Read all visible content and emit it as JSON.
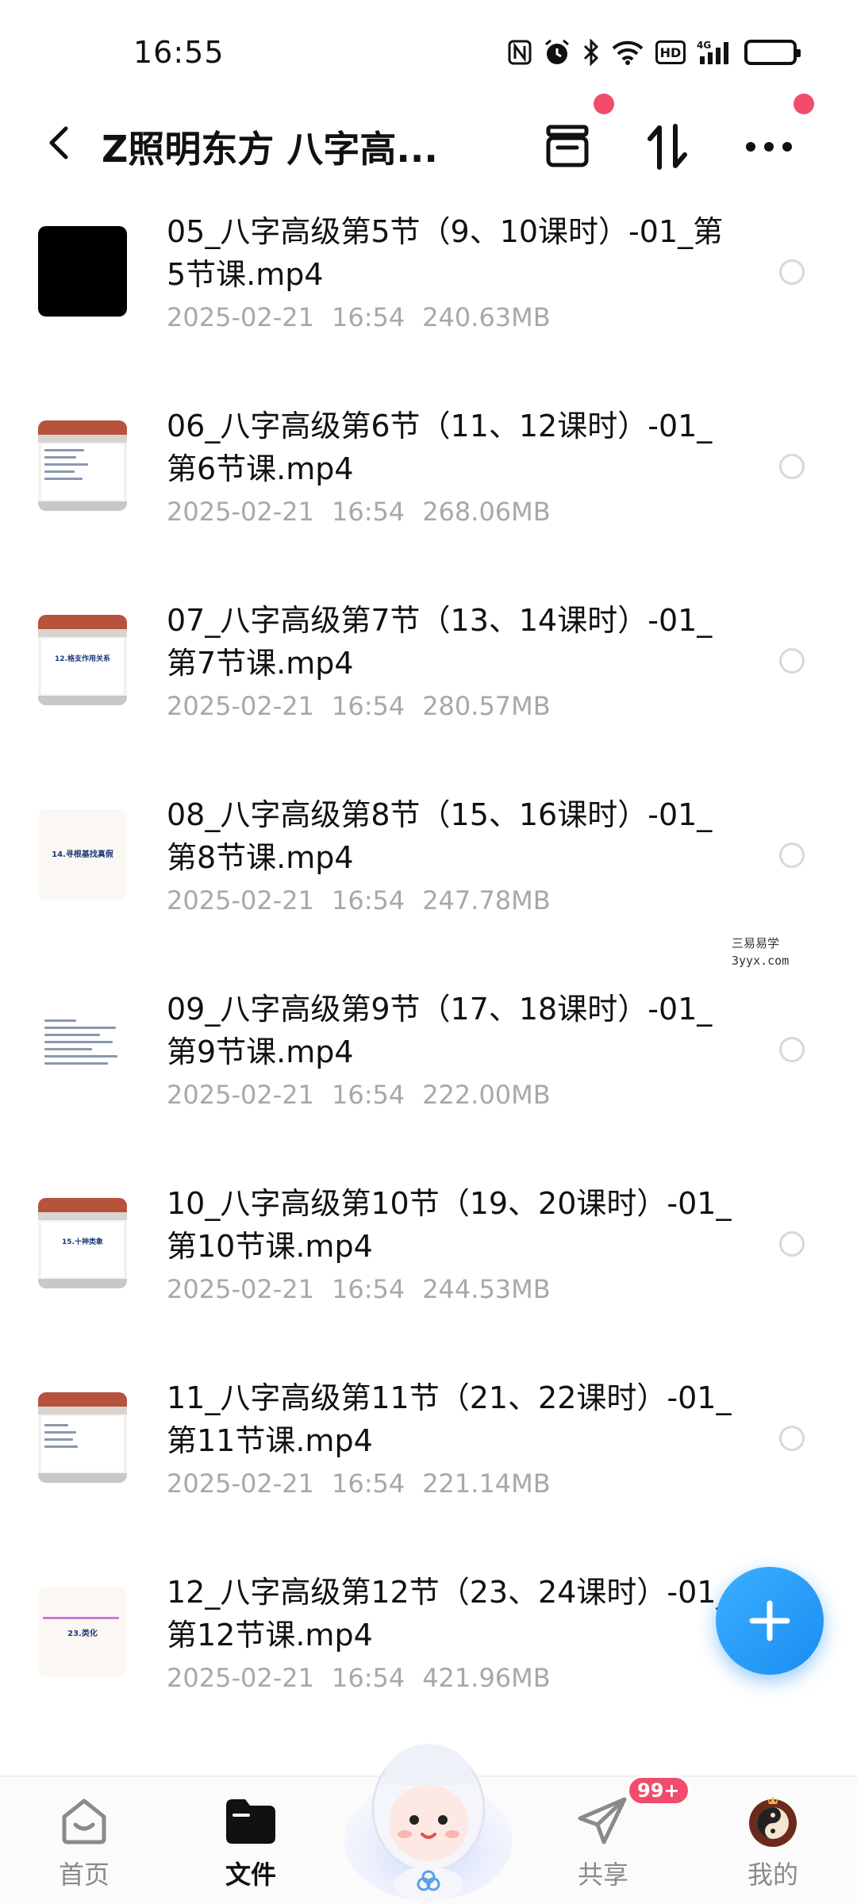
{
  "status": {
    "time": "16:55"
  },
  "header": {
    "title": "Z照明东方 八字高..."
  },
  "files": [
    {
      "name": "05_八字高级第5节（9、10课时）-01_第5节课.mp4",
      "date": "2025-02-21",
      "time": "16:54",
      "size": "240.63MB",
      "thumb": "black"
    },
    {
      "name": "06_八字高级第6节（11、12课时）-01_第6节课.mp4",
      "date": "2025-02-21",
      "time": "16:54",
      "size": "268.06MB",
      "thumb": "slide-lines"
    },
    {
      "name": "07_八字高级第7节（13、14课时）-01_第7节课.mp4",
      "date": "2025-02-21",
      "time": "16:54",
      "size": "280.57MB",
      "thumb": "slide-title",
      "thumb_text": "12.格支作用关系"
    },
    {
      "name": "08_八字高级第8节（15、16课时）-01_第8节课.mp4",
      "date": "2025-02-21",
      "time": "16:54",
      "size": "247.78MB",
      "thumb": "plain-title",
      "thumb_text": "14.寻根基找真假"
    },
    {
      "name": "09_八字高级第9节（17、18课时）-01_第9节课.mp4",
      "date": "2025-02-21",
      "time": "16:54",
      "size": "222.00MB",
      "thumb": "text-page"
    },
    {
      "name": "10_八字高级第10节（19、20课时）-01_第10节课.mp4",
      "date": "2025-02-21",
      "time": "16:54",
      "size": "244.53MB",
      "thumb": "slide-title",
      "thumb_text": "15.十神类象"
    },
    {
      "name": "11_八字高级第11节（21、22课时）-01_第11节课.mp4",
      "date": "2025-02-21",
      "time": "16:54",
      "size": "221.14MB",
      "thumb": "slide-lines"
    },
    {
      "name": "12_八字高级第12节（23、24课时）-01_第12节课.mp4",
      "date": "2025-02-21",
      "time": "16:54",
      "size": "421.96MB",
      "thumb": "plain-title",
      "thumb_text": "23.类化"
    }
  ],
  "watermark": {
    "line1": "三易易学",
    "line2": "3yyx.com"
  },
  "nav": {
    "home": "首页",
    "files": "文件",
    "share": "共享",
    "mine": "我的",
    "share_badge": "99+"
  },
  "colors": {
    "accent": "#1b8cf2",
    "notify": "#f24b6b",
    "meta": "#a8a8a8"
  }
}
